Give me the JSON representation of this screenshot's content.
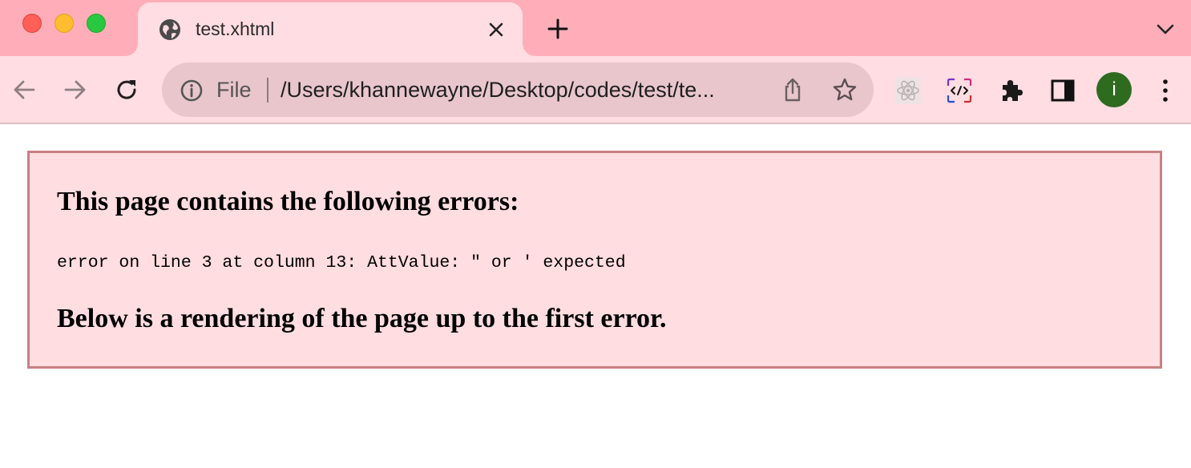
{
  "tab": {
    "title": "test.xhtml"
  },
  "omnibox": {
    "scheme_label": "File",
    "url": "/Users/khannewayne/Desktop/codes/test/te..."
  },
  "profile": {
    "initial": "i"
  },
  "error_page": {
    "heading": "This page contains the following errors:",
    "message": "error on line 3 at column 13: AttValue: \" or ' expected",
    "footer": "Below is a rendering of the page up to the first error."
  },
  "colors": {
    "tabstrip_bg": "#ffaeb9",
    "toolbar_bg": "#ffdde2",
    "error_bg": "#ffdde0",
    "error_border": "#c98183",
    "avatar_bg": "#2e6b1f"
  },
  "icons": [
    "globe-icon",
    "close-icon",
    "plus-icon",
    "chevron-down-icon",
    "back-arrow-icon",
    "forward-arrow-icon",
    "reload-icon",
    "info-icon",
    "share-icon",
    "star-icon",
    "react-icon",
    "code-icon",
    "puzzle-icon",
    "side-panel-icon",
    "kebab-menu-icon"
  ]
}
